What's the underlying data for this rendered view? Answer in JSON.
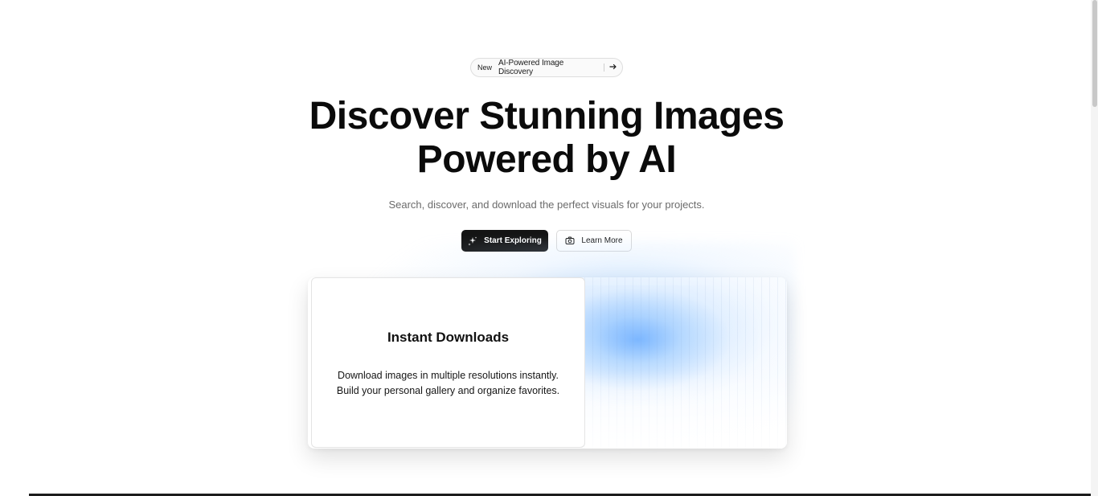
{
  "announcement": {
    "badge": "New",
    "text": "AI-Powered Image Discovery",
    "arrow_icon": "arrow-right-icon"
  },
  "hero": {
    "title_line1": "Discover Stunning Images",
    "title_line2": "Powered by AI",
    "subtitle": "Search, discover, and download the perfect visuals for your projects."
  },
  "buttons": {
    "primary_label": "Start Exploring",
    "primary_icon": "sparkles-icon",
    "secondary_label": "Learn More",
    "secondary_icon": "camera-icon"
  },
  "feature_card": {
    "title": "Instant Downloads",
    "description_line1": "Download images in multiple resolutions instantly.",
    "description_line2": "Build your personal gallery and organize favorites."
  },
  "colors": {
    "primary_button": "#141414",
    "accent_glow": "#78b4ff",
    "text": "#0a0a0a",
    "muted_text": "#6b6b6b"
  }
}
